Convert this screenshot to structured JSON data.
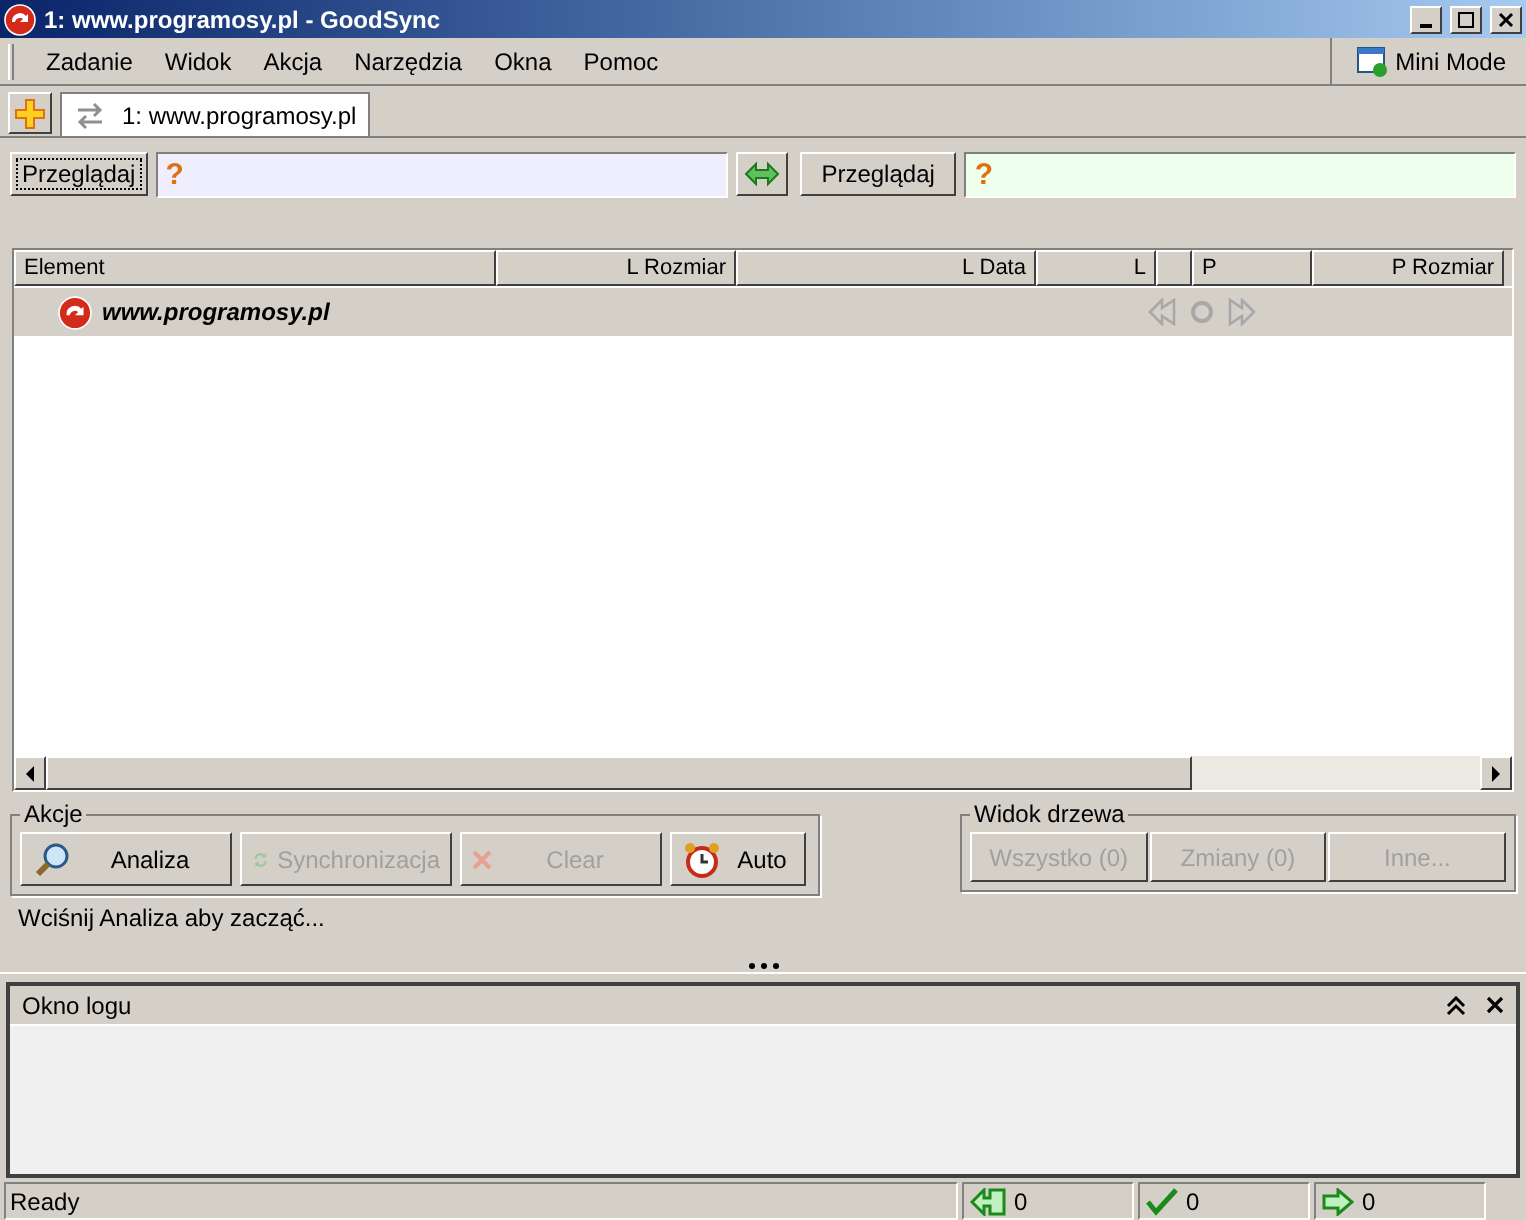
{
  "window": {
    "title": "1: www.programosy.pl - GoodSync"
  },
  "menu": [
    "Zadanie",
    "Widok",
    "Akcja",
    "Narzędzia",
    "Okna",
    "Pomoc"
  ],
  "mini_mode": "Mini Mode",
  "tabs": [
    {
      "label": "1: www.programosy.pl",
      "selected": true
    }
  ],
  "left": {
    "browse": "Przeglądaj",
    "path": "?"
  },
  "right": {
    "browse": "Przeglądaj",
    "path": "?"
  },
  "table": {
    "columns": [
      "Element",
      "L Rozmiar",
      "L Data",
      "L",
      "",
      "P",
      "P Rozmiar"
    ],
    "rows": [
      {
        "name": "www.programosy.pl"
      }
    ]
  },
  "actions": {
    "title": "Akcje",
    "buttons": [
      {
        "label": "Analiza",
        "kind": "analyze",
        "disabled": false
      },
      {
        "label": "Synchronizacja",
        "kind": "sync",
        "disabled": true
      },
      {
        "label": "Clear",
        "kind": "clear",
        "disabled": true
      },
      {
        "label": "Auto",
        "kind": "auto",
        "disabled": false
      }
    ]
  },
  "tree_view": {
    "title": "Widok drzewa",
    "buttons": [
      {
        "label": "Wszystko (0)",
        "disabled": true
      },
      {
        "label": "Zmiany (0)",
        "disabled": true
      },
      {
        "label": "Inne...",
        "disabled": true
      }
    ]
  },
  "hint": "Wciśnij Analiza aby zacząć...",
  "log": {
    "title": "Okno logu"
  },
  "status_bar": {
    "text": "Ready",
    "counts": [
      {
        "kind": "left",
        "value": "0"
      },
      {
        "kind": "done",
        "value": "0"
      },
      {
        "kind": "right",
        "value": "0"
      }
    ]
  }
}
